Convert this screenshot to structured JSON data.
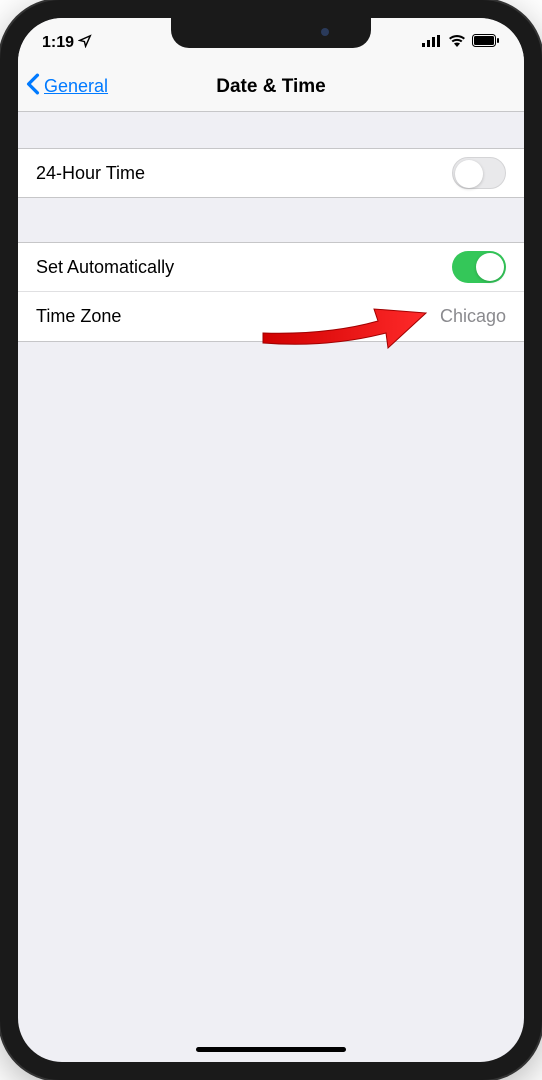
{
  "status": {
    "time": "1:19"
  },
  "nav": {
    "back_label": "General",
    "title": "Date & Time"
  },
  "rows": {
    "twenty_four_hour": {
      "label": "24-Hour Time",
      "on": false
    },
    "set_automatically": {
      "label": "Set Automatically",
      "on": true
    },
    "time_zone": {
      "label": "Time Zone",
      "value": "Chicago"
    }
  }
}
